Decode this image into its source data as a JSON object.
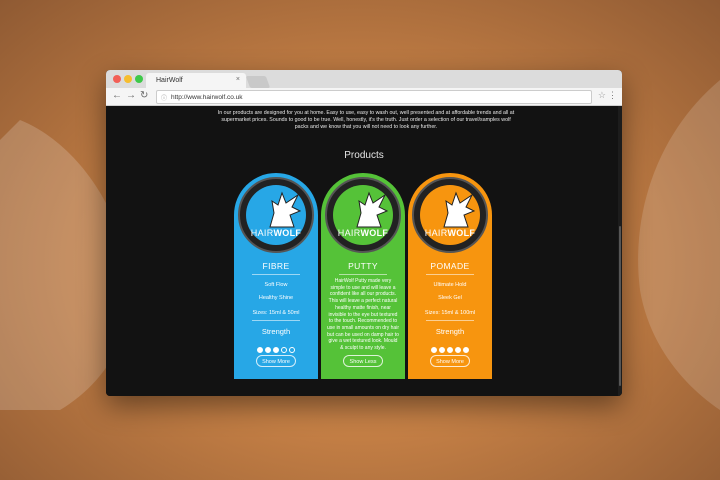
{
  "browser": {
    "tab_title": "HairWolf",
    "tab_close": "×",
    "url": "http://www.hairwolf.co.uk",
    "back": "←",
    "forward": "→",
    "reload": "↻",
    "star": "☆",
    "menu": "⋮"
  },
  "page": {
    "intro_text": "In our products are designed for you at home. Easy to use, easy to wash out, well presented and at affordable trends and all at supermarket prices. Sounds to good to be true. Well, honestly, it's the truth. Just order a selection of our travel/samples wolf packs and we know that you will not need to look any further.",
    "section_title": "Products",
    "logo_light": "HAIR",
    "logo_bold": "WOLF"
  },
  "products": [
    {
      "name": "FIBRE",
      "color": "#27a7e6",
      "hold": "Soft Flow",
      "finish": "Healthy Shine",
      "sizes": "Sizes: 15ml & 50ml",
      "strength_label": "Strength",
      "strength": 3,
      "button": "Show More"
    },
    {
      "name": "PUTTY",
      "color": "#55c238",
      "description": "HairWolf Putty made very simple to use and will leave a confident like all our products. This will leave a perfect natural healthy matte finish, near invisible to the eye but textured to the touch. Recommended to use in small amounts on dry hair but can be used on damp hair to give a wet textured look. Mould & sculpt to any style.",
      "button": "Show Less"
    },
    {
      "name": "POMADE",
      "color": "#f7950f",
      "hold": "Ultimate Hold",
      "finish": "Sleek Gel",
      "sizes": "Sizes: 15ml & 100ml",
      "strength_label": "Strength",
      "strength": 5,
      "button": "Show More"
    }
  ]
}
